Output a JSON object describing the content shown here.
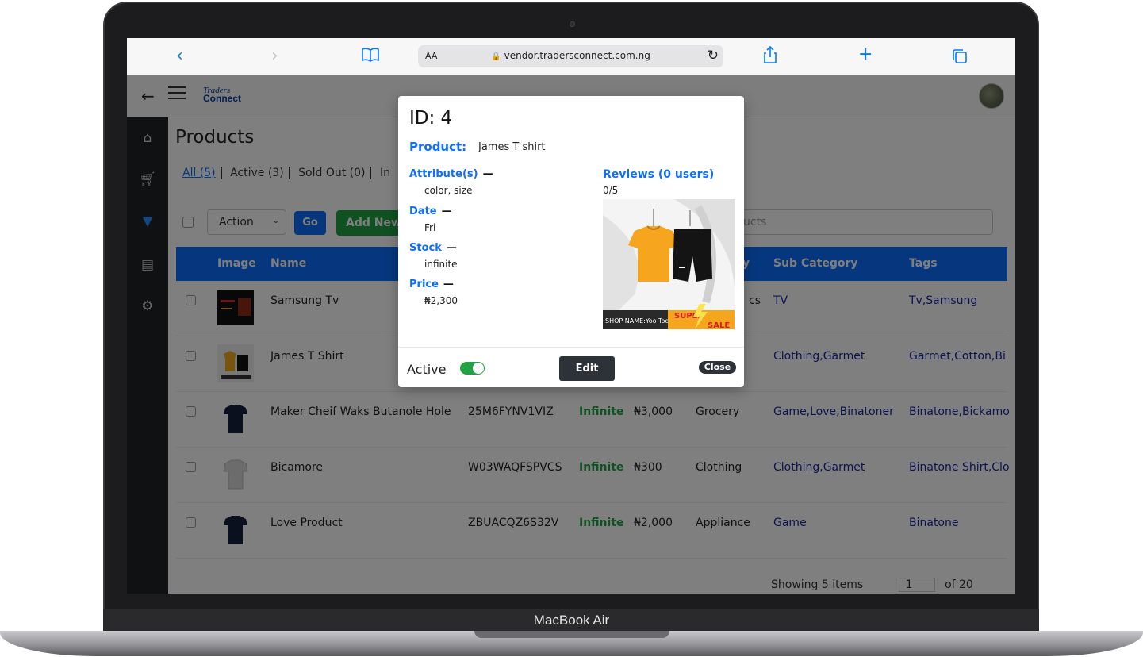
{
  "device": {
    "brand": "MacBook Air"
  },
  "browser": {
    "text_size_label": "AA",
    "url": "vendor.tradersconnect.com.ng"
  },
  "app": {
    "logo_line1": "Traders",
    "logo_line2": "Connect",
    "page_title": "Products",
    "filters": [
      "All (5)",
      "Active (3)",
      "Sold Out (0)",
      "In"
    ],
    "toolbar": {
      "action_label": "Action",
      "go_label": "Go",
      "add_label": "Add New",
      "search_placeholder": "r products"
    },
    "table": {
      "headers": [
        "Image",
        "Name",
        "y",
        "Sub Category",
        "Tags"
      ],
      "rows": [
        {
          "name": "Samsung Tv",
          "sku": "",
          "stock": "",
          "price": "",
          "category": "cs",
          "sub_category": "TV",
          "tags": "Tv,Samsung"
        },
        {
          "name": "James T Shirt",
          "sku": "",
          "stock": "",
          "price": "",
          "category": "",
          "sub_category": "Clothing,Garmet",
          "tags": "Garmet,Cotton,Bi"
        },
        {
          "name": "Maker Cheif Waks Butanole Hole",
          "sku": "25M6FYNV1VIZ",
          "stock": "Infinite",
          "price": "₦3,000",
          "category": "Grocery",
          "sub_category": "Game,Love,Binatoner",
          "tags": "Binatone,Bickamo"
        },
        {
          "name": "Bicamore",
          "sku": "W03WAQFSPVCS",
          "stock": "Infinite",
          "price": "₦300",
          "category": "Clothing",
          "sub_category": "Clothing,Garmet",
          "tags": "Binatone Shirt,Clo"
        },
        {
          "name": "Love Product",
          "sku": "ZBUACQZ6S32V",
          "stock": "Infinite",
          "price": "₦2,000",
          "category": "Appliance",
          "sub_category": "Game",
          "tags": "Binatone"
        }
      ]
    },
    "pager": {
      "showing": "Showing 5 items",
      "page": "1",
      "of": "of 20"
    }
  },
  "modal": {
    "id_text": "ID: 4",
    "product_label": "Product:",
    "product_value": "James T shirt",
    "attributes_label": "Attribute(s)",
    "attributes_value": "color, size",
    "date_label": "Date",
    "date_value": "Fri",
    "stock_label": "Stock",
    "stock_value": "infinite",
    "price_label": "Price",
    "price_value": "₦2,300",
    "reviews_label": "Reviews (0 users)",
    "rating": "0/5",
    "image_caption": "SHOP NAME:Yoo Too",
    "image_badge_1": "SUPER",
    "image_badge_2": "SALE",
    "active_label": "Active",
    "active_on": true,
    "edit_label": "Edit",
    "close_label": "Close"
  },
  "colors": {
    "primary": "#0d6efd",
    "success": "#21a345",
    "dark": "#2d3238",
    "sidebar": "#1f2327"
  }
}
